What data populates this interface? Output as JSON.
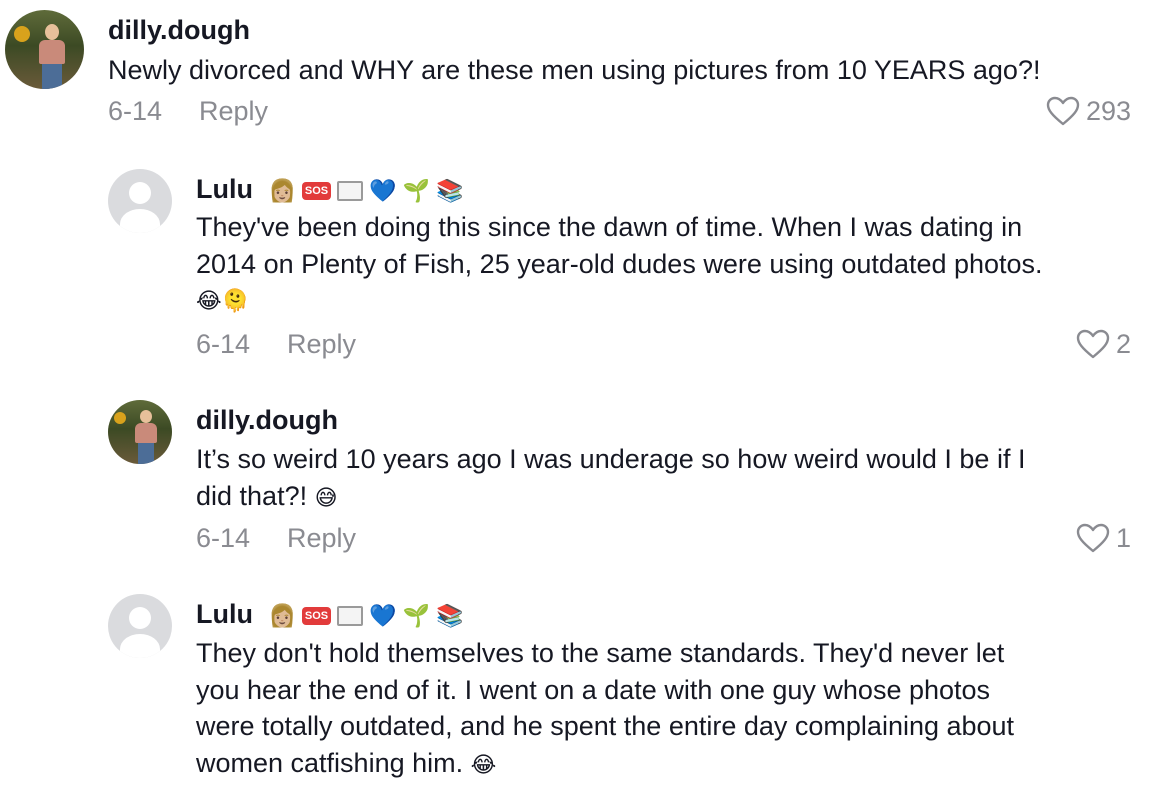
{
  "comments": [
    {
      "username": "dilly.dough",
      "text": "Newly divorced and WHY are these men using pictures from 10 YEARS ago?!",
      "date": "6-14",
      "reply_label": "Reply",
      "likes": "293"
    },
    {
      "username": "Lulu",
      "badges": [
        "👩🏼",
        "SOS",
        "🏳️",
        "💙",
        "🌱",
        "📚"
      ],
      "text_line1": "They've been doing this since the dawn of time. When I was dating in",
      "text_line2": "2014 on Plenty of Fish, 25 year-old dudes were using outdated photos.",
      "text_emojis": "😂🫠",
      "date": "6-14",
      "reply_label": "Reply",
      "likes": "2"
    },
    {
      "username": "dilly.dough",
      "text_line1": "It’s so weird 10 years ago I was underage so how weird would I be if I",
      "text_line2": "did that?!",
      "text_emoji": "😅",
      "date": "6-14",
      "reply_label": "Reply",
      "likes": "1"
    },
    {
      "username": "Lulu",
      "badges": [
        "👩🏼",
        "SOS",
        "🏳️",
        "💙",
        "🌱",
        "📚"
      ],
      "text_line1": "They don't hold themselves to the same standards. They'd never let",
      "text_line2": "you hear the end of it. I went on a date with one guy whose photos",
      "text_line3": "were totally outdated, and he spent the entire day complaining about",
      "text_line4": "women catfishing him.",
      "text_emoji": "😂"
    }
  ],
  "icons": {
    "like": "heart-outline-icon",
    "avatar_default": "default-avatar-icon"
  },
  "colors": {
    "text": "#161823",
    "secondary": "#8a8b91",
    "avatar_bg": "#dadbde"
  }
}
